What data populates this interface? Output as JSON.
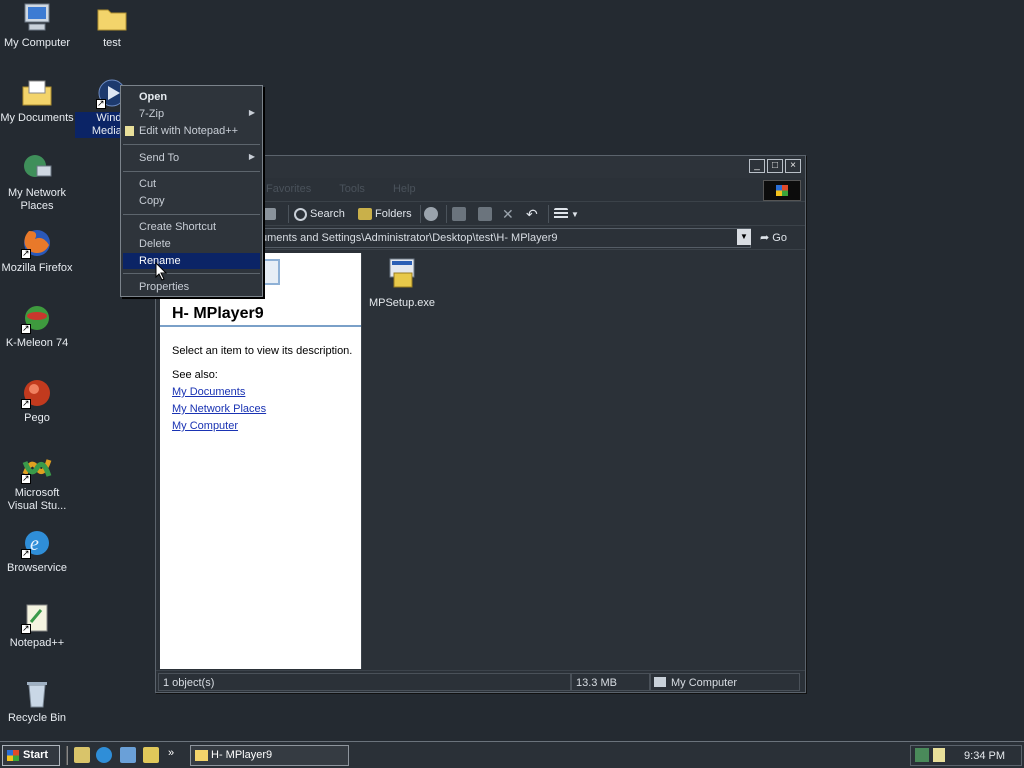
{
  "desktop": {
    "icons": [
      {
        "label": "My Computer"
      },
      {
        "label": "test"
      },
      {
        "label": "My Documents"
      },
      {
        "label": "Windows Media Player"
      },
      {
        "label": "My Network Places"
      },
      {
        "label": "Mozilla Firefox"
      },
      {
        "label": "K-Meleon 74"
      },
      {
        "label": "Pego"
      },
      {
        "label": "Microsoft Visual Stu..."
      },
      {
        "label": "Browservice"
      },
      {
        "label": "Notepad++"
      },
      {
        "label": "Recycle Bin"
      }
    ],
    "wmp_label_visible_1": "Windo",
    "wmp_label_visible_2": "Media P"
  },
  "context_menu": {
    "items": [
      {
        "label": "Open"
      },
      {
        "label": "7-Zip"
      },
      {
        "label": "Edit with Notepad++"
      },
      {
        "label": "Send To"
      },
      {
        "label": "Cut"
      },
      {
        "label": "Copy"
      },
      {
        "label": "Create Shortcut"
      },
      {
        "label": "Delete"
      },
      {
        "label": "Rename"
      },
      {
        "label": "Properties"
      }
    ]
  },
  "explorer": {
    "menu": {
      "m1": "Favorites",
      "m2": "Tools",
      "m3": "Help"
    },
    "toolbar": {
      "search": "Search",
      "folders": "Folders"
    },
    "address": "uments and Settings\\Administrator\\Desktop\\test\\H- MPlayer9",
    "go": "Go",
    "left_pane": {
      "title": "H- MPlayer9",
      "description": "Select an item to view its description.",
      "see_also": "See also:",
      "links": [
        "My Documents",
        "My Network Places",
        "My Computer"
      ]
    },
    "files": [
      {
        "name": "MPSetup.exe"
      }
    ],
    "status": {
      "objects": "1 object(s)",
      "size": "13.3 MB",
      "zone": "My Computer"
    }
  },
  "taskbar": {
    "start": "Start",
    "task": "H- MPlayer9",
    "clock": "9:34 PM"
  }
}
